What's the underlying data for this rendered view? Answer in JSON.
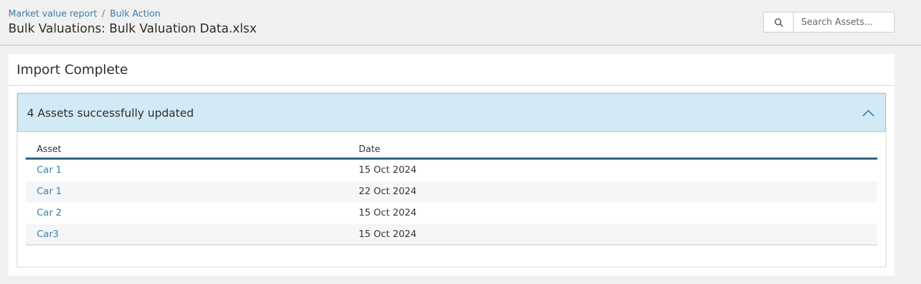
{
  "breadcrumb": {
    "items": [
      "Market value report",
      "Bulk Action"
    ],
    "separator": "/"
  },
  "page_title": "Bulk Valuations: Bulk Valuation Data.xlsx",
  "search": {
    "placeholder": "Search Assets...",
    "value": "",
    "icon": "search-icon"
  },
  "card": {
    "title": "Import Complete",
    "panel": {
      "label": "4 Assets successfully updated",
      "icon": "chevron-up-icon",
      "header_color": "#d2eaf5"
    },
    "table": {
      "columns": [
        "Asset",
        "Date"
      ],
      "rows": [
        {
          "asset": "Car 1",
          "date": "15 Oct 2024"
        },
        {
          "asset": "Car 1",
          "date": "22 Oct 2024"
        },
        {
          "asset": "Car 2",
          "date": "15 Oct 2024"
        },
        {
          "asset": "Car3",
          "date": "15 Oct 2024"
        }
      ]
    }
  },
  "colors": {
    "link": "#3a7fa6",
    "table_header_border": "#2f5f80"
  }
}
